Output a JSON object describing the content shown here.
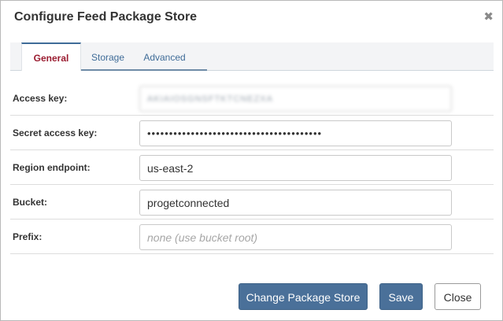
{
  "dialog": {
    "title": "Configure Feed Package Store",
    "close_glyph": "✖"
  },
  "tabs": [
    {
      "label": "General",
      "active": true
    },
    {
      "label": "Storage",
      "active": false
    },
    {
      "label": "Advanced",
      "active": false
    }
  ],
  "form": {
    "access_key": {
      "label": "Access key:",
      "value": "AKIAIOSGNSFTKTCNEZXA"
    },
    "secret_access_key": {
      "label": "Secret access key:",
      "value": "••••••••••••••••••••••••••••••••••••••••"
    },
    "region_endpoint": {
      "label": "Region endpoint:",
      "value": "us-east-2"
    },
    "bucket": {
      "label": "Bucket:",
      "value": "progetconnected"
    },
    "prefix": {
      "label": "Prefix:",
      "value": "",
      "placeholder": "none (use bucket root)"
    }
  },
  "buttons": {
    "change_store": "Change Package Store",
    "save": "Save",
    "close": "Close"
  },
  "colors": {
    "primary_button": "#4a7099",
    "active_tab_text": "#9a1c30",
    "tab_link": "#3f6c98"
  },
  "icons": {
    "close": "close-icon"
  }
}
